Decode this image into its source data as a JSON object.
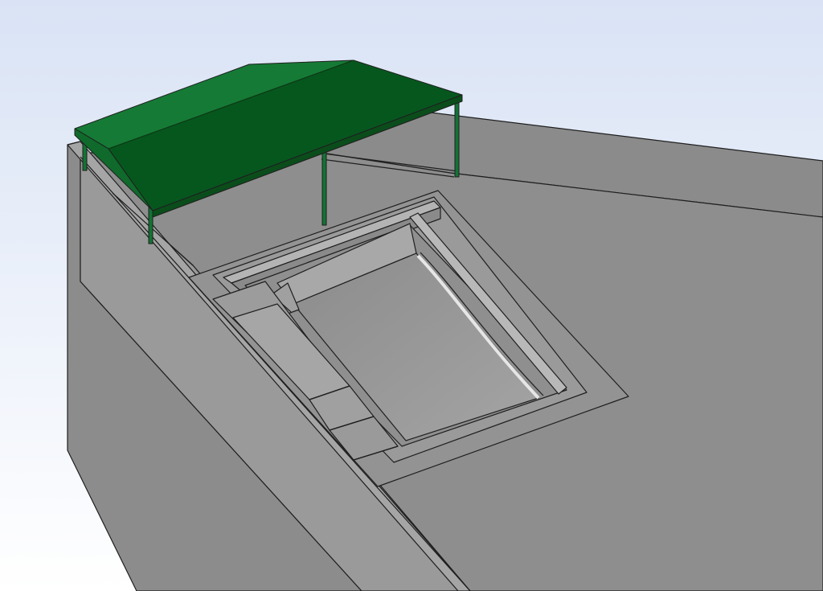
{
  "viewport": {
    "background_top": "#d9e3f5",
    "background_bottom": "#ffffff"
  },
  "colors": {
    "deck_top": "#8e8e8e",
    "wall_front": "#8a8a8a",
    "wall_left": "#a3a3a3",
    "wall_top": "#9c9c9c",
    "coping": "#9a9a9a",
    "pool_floor": "#959595",
    "pool_wall_light": "#b3b3b3",
    "pool_wall_dark": "#7e7e7e",
    "canopy_light": "#157a35",
    "canopy_dark": "#06571e",
    "canopy_mid": "#0f6a2b",
    "canopy_pole": "#127334",
    "edge_line": "#1f1f1f"
  }
}
